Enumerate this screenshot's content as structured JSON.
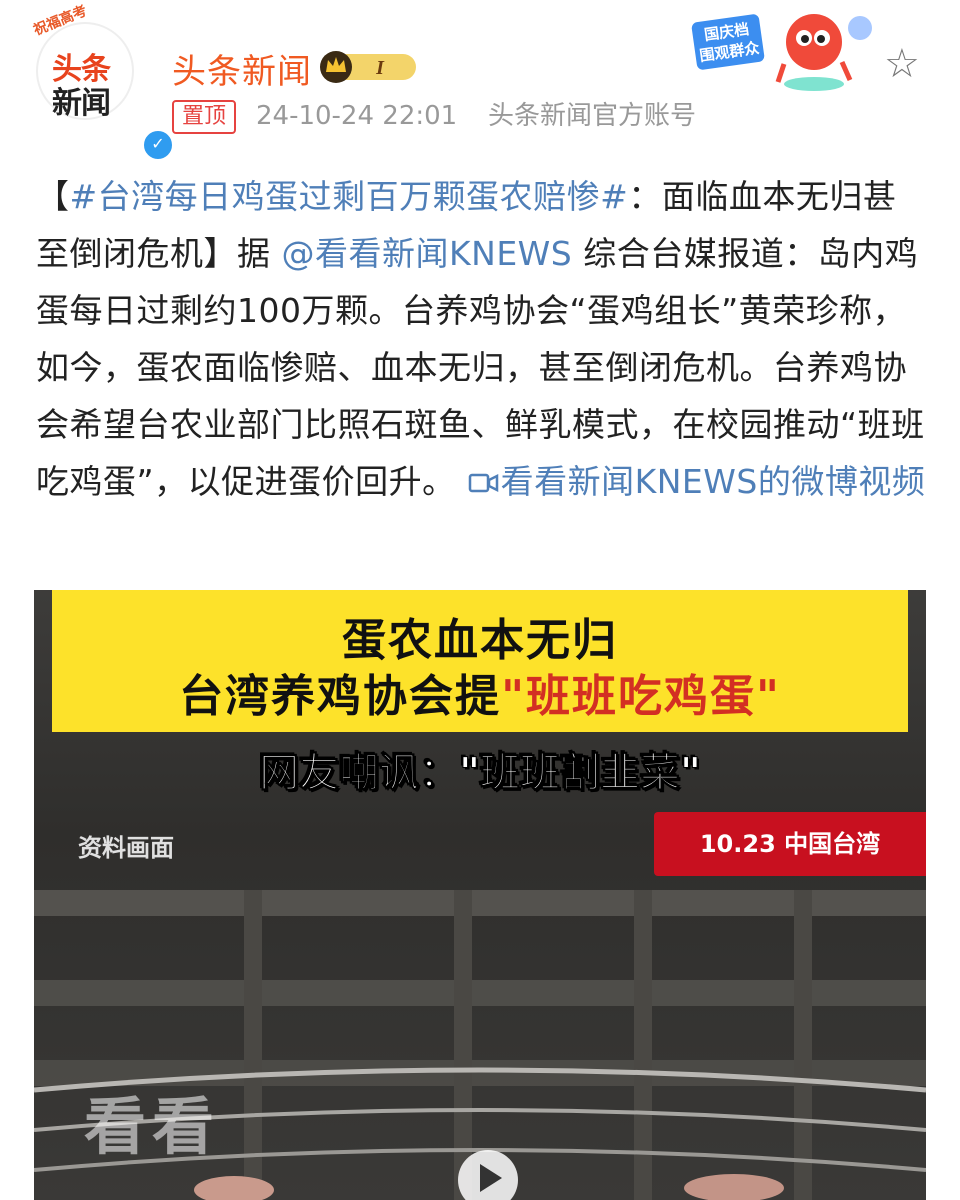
{
  "header": {
    "avatar_arc": "祝福高考",
    "avatar_line1": "头条",
    "avatar_line2": "新闻",
    "name": "头条新闻",
    "level": "I",
    "pin_label": "置顶",
    "time": "24-10-24 22:01",
    "source": "头条新闻官方账号",
    "badge_text": "国庆档 围观群众"
  },
  "post": {
    "open": "【",
    "hashtag": "#台湾每日鸡蛋过剩百万颗蛋农赔惨#",
    "headline_rest": "：面临血本无归甚至倒闭危机】据",
    "mention": "@看看新闻KNEWS",
    "body": "综合台媒报道：岛内鸡蛋每日过剩约100万颗。台养鸡协会“蛋鸡组长”黄荣珍称，如今，蛋农面临惨赔、血本无归，甚至倒闭危机。台养鸡协会希望台农业部门比照石斑鱼、鲜乳模式，在校园推动“班班吃鸡蛋”，以促进蛋价回升。",
    "video_link": "看看新闻KNEWS的微博视频"
  },
  "media": {
    "banner_line1": "蛋农血本无归",
    "banner_line2_a": "台湾养鸡协会提",
    "banner_line2_b": "\"班班吃鸡蛋\"",
    "caption": "网友嘲讽：\"班班割韭菜\"",
    "archive_label": "资料画面",
    "date_tag": "10.23 中国台湾",
    "watermark": "看看"
  }
}
